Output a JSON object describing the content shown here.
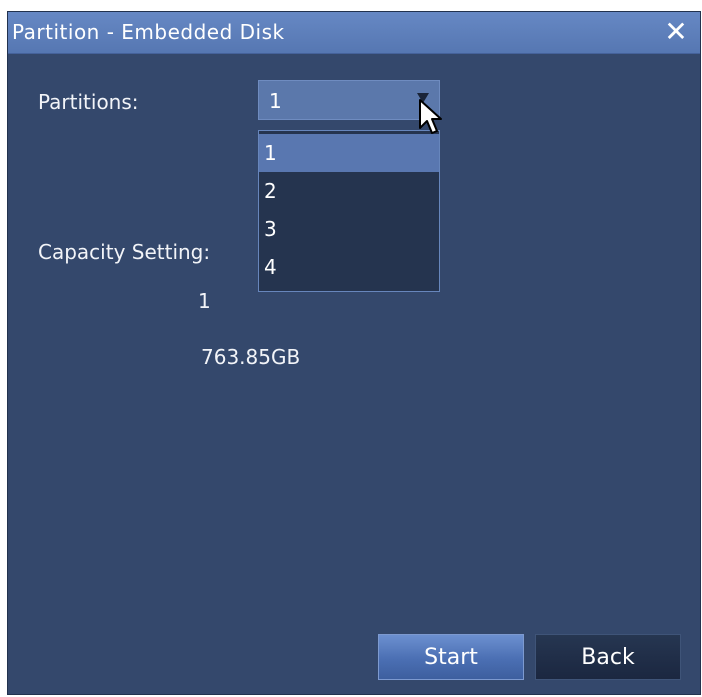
{
  "dialog": {
    "title": "Partition - Embedded Disk",
    "close_icon": "close-icon"
  },
  "partitions": {
    "label": "Partitions:",
    "selected_value": "1",
    "options": [
      "1",
      "2",
      "3",
      "4"
    ],
    "dropdown_open": true
  },
  "capacity": {
    "label": "Capacity Setting:",
    "partition_index": "1",
    "size": "763.85GB"
  },
  "buttons": {
    "start": "Start",
    "back": "Back"
  },
  "colors": {
    "window_bg": "#34486c",
    "titlebar": "#5b7bb6",
    "dropdown_bg": "#25344f",
    "selection": "#5977b0"
  }
}
